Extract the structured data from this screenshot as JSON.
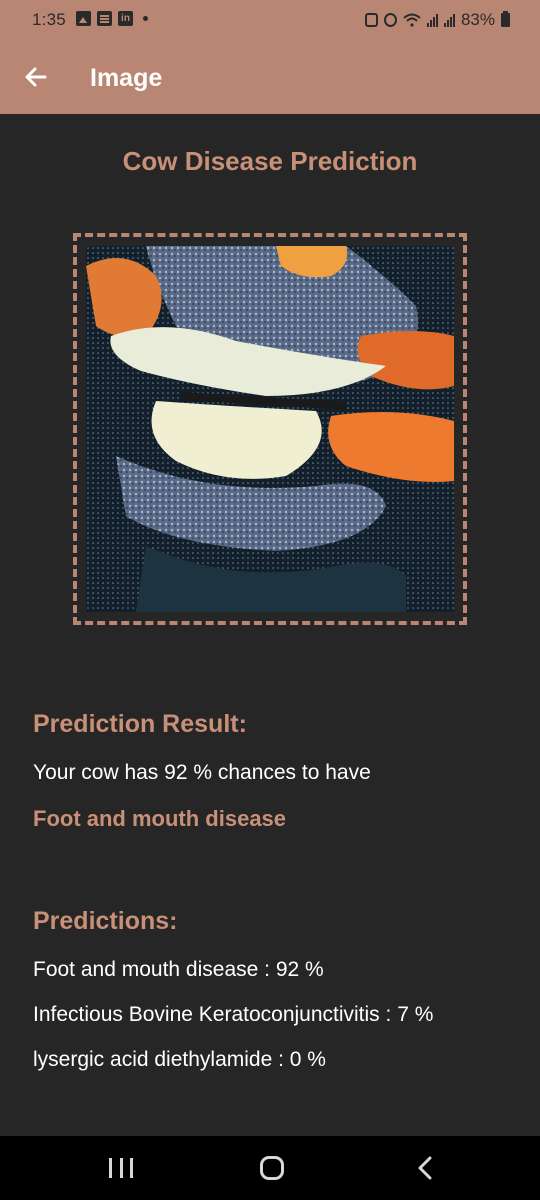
{
  "status_bar": {
    "time": "1:35",
    "battery": "83%",
    "left_icons": [
      "gallery-icon",
      "news-icon",
      "linkedin-icon"
    ],
    "right_icons": [
      "nfc-icon",
      "alarm-icon",
      "wifi-icon",
      "signal-icon",
      "signal-icon",
      "battery-icon"
    ]
  },
  "app_bar": {
    "back_icon": "arrow-left-icon",
    "title": "Image",
    "color": "#b98674"
  },
  "content": {
    "heading": "Cow Disease Prediction",
    "image_alt_icon": "cow-photo",
    "result": {
      "title": "Prediction Result:",
      "sentence": "Your cow has  92 % chances to have",
      "disease": "Foot and mouth disease"
    },
    "predictions": {
      "title": "Predictions:",
      "items": [
        "Foot and mouth disease : 92 %",
        "Infectious Bovine Keratoconjunctivitis : 7 %",
        "lysergic acid diethylamide : 0 %"
      ]
    }
  },
  "nav_bar": {
    "icons": [
      "recent-apps-icon",
      "home-icon",
      "back-icon"
    ]
  },
  "colors": {
    "accent": "#c99078",
    "bar": "#b98674",
    "background": "#262626"
  }
}
